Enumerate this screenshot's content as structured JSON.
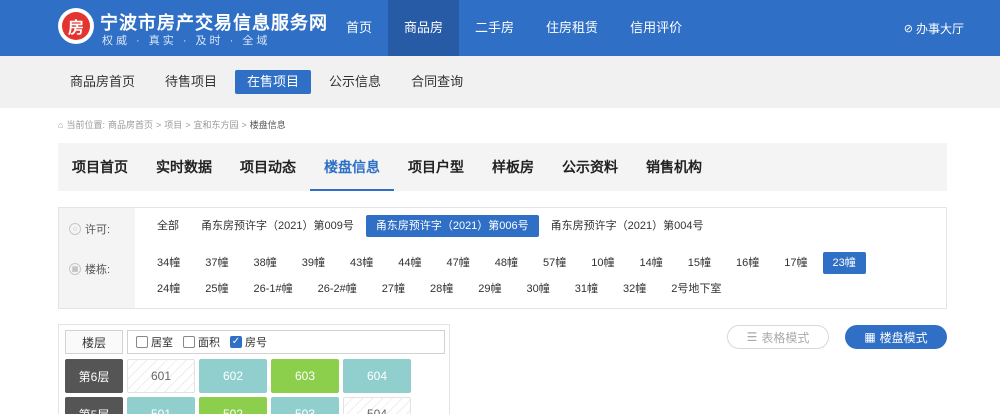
{
  "header": {
    "logo_char": "房",
    "site_title": "宁波市房产交易信息服务网",
    "slogan": "权威 · 真实 · 及时 · 全域",
    "nav": [
      {
        "label": "首页",
        "active": false
      },
      {
        "label": "商品房",
        "active": true
      },
      {
        "label": "二手房",
        "active": false
      },
      {
        "label": "住房租赁",
        "active": false
      },
      {
        "label": "信用评价",
        "active": false
      }
    ],
    "office_label": "办事大厅",
    "office_icon": "compass-icon"
  },
  "subnav": [
    {
      "label": "商品房首页",
      "active": false
    },
    {
      "label": "待售项目",
      "active": false
    },
    {
      "label": "在售项目",
      "active": true
    },
    {
      "label": "公示信息",
      "active": false
    },
    {
      "label": "合同查询",
      "active": false
    }
  ],
  "breadcrumb": {
    "prefix": "当前位置:",
    "items": [
      "商品房首页",
      "项目",
      "宜和东方园"
    ],
    "current": "楼盘信息"
  },
  "tabs": [
    {
      "label": "项目首页",
      "active": false
    },
    {
      "label": "实时数据",
      "active": false
    },
    {
      "label": "项目动态",
      "active": false
    },
    {
      "label": "楼盘信息",
      "active": true
    },
    {
      "label": "项目户型",
      "active": false
    },
    {
      "label": "样板房",
      "active": false
    },
    {
      "label": "公示资料",
      "active": false
    },
    {
      "label": "销售机构",
      "active": false
    }
  ],
  "filters": {
    "permit_label": "许可:",
    "permits": [
      {
        "label": "全部",
        "active": false
      },
      {
        "label": "甬东房预许字（2021）第009号",
        "active": false
      },
      {
        "label": "甬东房预许字（2021）第006号",
        "active": true
      },
      {
        "label": "甬东房预许字（2021）第004号",
        "active": false
      }
    ],
    "building_label": "楼栋:",
    "buildings_row1": [
      {
        "label": "34幢",
        "active": false
      },
      {
        "label": "37幢",
        "active": false
      },
      {
        "label": "38幢",
        "active": false
      },
      {
        "label": "39幢",
        "active": false
      },
      {
        "label": "43幢",
        "active": false
      },
      {
        "label": "44幢",
        "active": false
      },
      {
        "label": "47幢",
        "active": false
      },
      {
        "label": "48幢",
        "active": false
      },
      {
        "label": "57幢",
        "active": false
      },
      {
        "label": "10幢",
        "active": false
      },
      {
        "label": "14幢",
        "active": false
      },
      {
        "label": "15幢",
        "active": false
      },
      {
        "label": "16幢",
        "active": false
      },
      {
        "label": "17幢",
        "active": false
      },
      {
        "label": "23幢",
        "active": true
      }
    ],
    "buildings_row2": [
      {
        "label": "24幢",
        "active": false
      },
      {
        "label": "25幢",
        "active": false
      },
      {
        "label": "26-1#幢",
        "active": false
      },
      {
        "label": "26-2#幢",
        "active": false
      },
      {
        "label": "27幢",
        "active": false
      },
      {
        "label": "28幢",
        "active": false
      },
      {
        "label": "29幢",
        "active": false
      },
      {
        "label": "30幢",
        "active": false
      },
      {
        "label": "31幢",
        "active": false
      },
      {
        "label": "32幢",
        "active": false
      },
      {
        "label": "2号地下室",
        "active": false
      }
    ]
  },
  "grid": {
    "floor_header": "楼层",
    "options": [
      {
        "label": "居室",
        "checked": false
      },
      {
        "label": "面积",
        "checked": false
      },
      {
        "label": "房号",
        "checked": true
      }
    ],
    "floors": [
      {
        "label": "第6层",
        "units": [
          {
            "no": "601",
            "status": "blank"
          },
          {
            "no": "602",
            "status": "teal"
          },
          {
            "no": "603",
            "status": "green"
          },
          {
            "no": "604",
            "status": "teal"
          }
        ]
      },
      {
        "label": "第5层",
        "units": [
          {
            "no": "501",
            "status": "teal"
          },
          {
            "no": "502",
            "status": "green"
          },
          {
            "no": "503",
            "status": "teal"
          },
          {
            "no": "504",
            "status": "blank"
          }
        ]
      }
    ]
  },
  "view_modes": {
    "table_label": "表格模式",
    "building_label": "楼盘模式"
  },
  "colors": {
    "primary": "#2f6fc5",
    "available": "#90cfcd",
    "sold": "#8ccf4c"
  }
}
